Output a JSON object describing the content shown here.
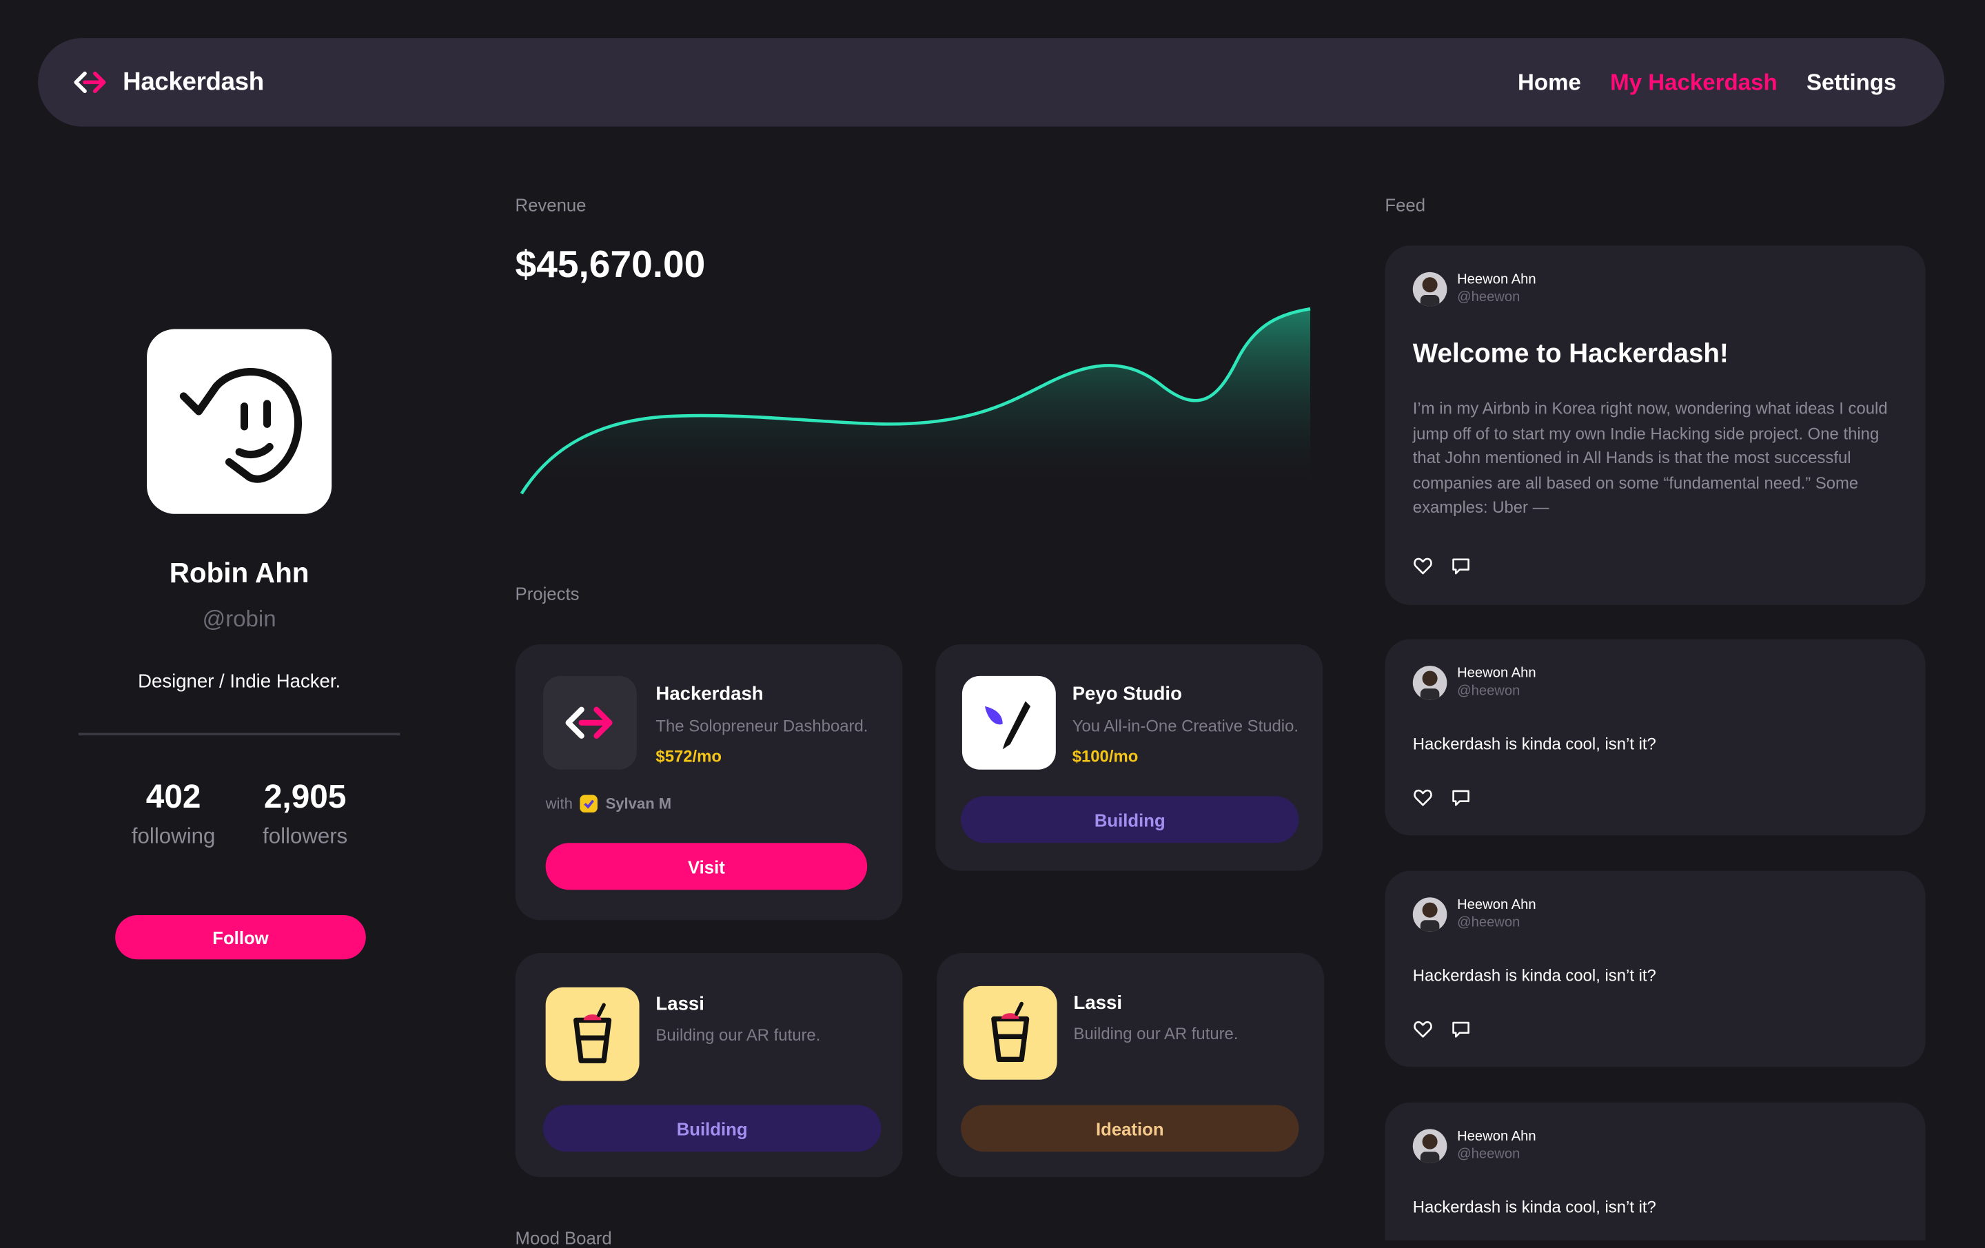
{
  "app": {
    "name": "Hackerdash"
  },
  "nav": {
    "links": [
      {
        "label": "Home"
      },
      {
        "label": "My Hackerdash"
      },
      {
        "label": "Settings"
      }
    ],
    "active": "My Hackerdash"
  },
  "profile": {
    "name": "Robin Ahn",
    "handle": "@robin",
    "bio": "Designer / Indie Hacker.",
    "following_count": "402",
    "following_label": "following",
    "followers_count": "2,905",
    "followers_label": "followers",
    "follow_label": "Follow"
  },
  "revenue": {
    "label": "Revenue",
    "amount": "$45,670.00",
    "accent": "#2ee6b9"
  },
  "projects": {
    "label": "Projects",
    "items": [
      {
        "title": "Hackerdash",
        "desc": "The Solopreneur Dashboard.",
        "price": "$572/mo",
        "with_label": "with",
        "collaborator": "Sylvan M",
        "button": "Visit",
        "icon": "hackerdash-logo-icon"
      },
      {
        "title": "Peyo Studio",
        "desc": "You All-in-One Creative Studio.",
        "price": "$100/mo",
        "status": "Building",
        "icon": "peyo-studio-logo-icon"
      },
      {
        "title": "Lassi",
        "desc": "Building our AR future.",
        "status": "Building",
        "icon": "lassi-cup-icon"
      },
      {
        "title": "Lassi",
        "desc": "Building our AR future.",
        "status": "Ideation",
        "icon": "lassi-cup-icon"
      }
    ]
  },
  "moodboard": {
    "label": "Mood Board"
  },
  "feed": {
    "label": "Feed",
    "posts": [
      {
        "author": "Heewon Ahn",
        "handle": "@heewon",
        "title": "Welcome to Hackerdash!",
        "body": "I’m in my Airbnb in Korea right now, wondering what ideas I could jump off of to start my own Indie Hacking side project. One thing that John mentioned in All Hands is that the most successful companies are all based on some “fundamental need.” Some examples: Uber —"
      },
      {
        "author": "Heewon Ahn",
        "handle": "@heewon",
        "text": "Hackerdash is kinda cool, isn’t it?"
      },
      {
        "author": "Heewon Ahn",
        "handle": "@heewon",
        "text": "Hackerdash is kinda cool, isn’t it?"
      },
      {
        "author": "Heewon Ahn",
        "handle": "@heewon",
        "text": "Hackerdash is kinda cool, isn’t it?"
      }
    ]
  },
  "colors": {
    "accent": "#ff0a78",
    "background": "#18171c",
    "card": "#232129",
    "nav": "#2f2b3a"
  }
}
